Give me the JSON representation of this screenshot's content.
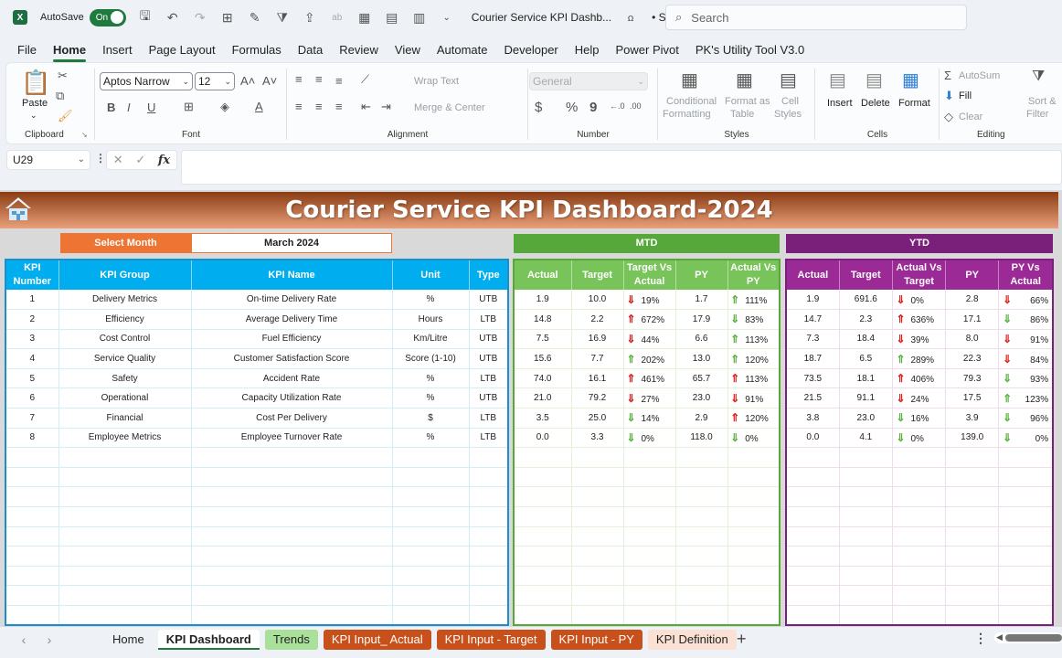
{
  "titlebar": {
    "app_icon": "excel-icon",
    "autosave_label": "AutoSave",
    "autosave_state": "On",
    "doc_title": "Courier Service KPI Dashb...",
    "saved_status": "• Saved",
    "search_placeholder": "Search"
  },
  "menu": {
    "tabs": [
      "File",
      "Home",
      "Insert",
      "Page Layout",
      "Formulas",
      "Data",
      "Review",
      "View",
      "Automate",
      "Developer",
      "Help",
      "Power Pivot",
      "PK's Utility Tool V3.0"
    ],
    "active": "Home"
  },
  "ribbon": {
    "clipboard": {
      "label": "Clipboard",
      "paste": "Paste"
    },
    "font": {
      "label": "Font",
      "font_name": "Aptos Narrow",
      "font_size": "12",
      "bold": "B",
      "italic": "I",
      "underline": "U"
    },
    "alignment": {
      "label": "Alignment",
      "wrap_text": "Wrap Text",
      "merge_center": "Merge & Center"
    },
    "number": {
      "label": "Number",
      "format": "General",
      "currency": "$",
      "percent": "%",
      "comma": "9"
    },
    "styles": {
      "label": "Styles",
      "conditional": "Conditional",
      "conditional2": "Formatting",
      "format_as": "Format as",
      "format_as2": "Table",
      "cell": "Cell",
      "cell2": "Styles"
    },
    "cells": {
      "label": "Cells",
      "insert": "Insert",
      "delete": "Delete",
      "format": "Format"
    },
    "editing": {
      "label": "Editing",
      "autosum": "AutoSum",
      "fill": "Fill",
      "clear": "Clear",
      "sort": "Sort &",
      "sort2": "Filter"
    }
  },
  "formula_bar": {
    "name_box": "U29",
    "formula": ""
  },
  "dashboard": {
    "title": "Courier Service KPI Dashboard-2024",
    "select_month_label": "Select Month",
    "selected_month": "March 2024",
    "mtd_label": "MTD",
    "ytd_label": "YTD",
    "kpi_headers": [
      "KPI Number",
      "KPI Group",
      "KPI Name",
      "Unit",
      "Type"
    ],
    "mtd_headers": [
      "Actual",
      "Target",
      "Target Vs Actual",
      "PY",
      "Actual Vs PY"
    ],
    "ytd_headers": [
      "Actual",
      "Target",
      "Actual Vs Target",
      "PY",
      "PY Vs Actual"
    ],
    "rows": [
      {
        "num": "1",
        "group": "Delivery Metrics",
        "name": "On-time Delivery Rate",
        "unit": "%",
        "type": "UTB",
        "mtd": {
          "actual": "1.9",
          "target": "10.0",
          "tva": "19%",
          "tva_dir": "down",
          "tva_color": "red",
          "py": "1.7",
          "avp": "111%",
          "avp_dir": "up",
          "avp_color": "green"
        },
        "ytd": {
          "actual": "1.9",
          "target": "691.6",
          "avt": "0%",
          "avt_dir": "down",
          "avt_color": "red",
          "py": "2.8",
          "pva": "66%",
          "pva_dir": "down",
          "pva_color": "red"
        }
      },
      {
        "num": "2",
        "group": "Efficiency",
        "name": "Average Delivery Time",
        "unit": "Hours",
        "type": "LTB",
        "mtd": {
          "actual": "14.8",
          "target": "2.2",
          "tva": "672%",
          "tva_dir": "up",
          "tva_color": "red",
          "py": "17.9",
          "avp": "83%",
          "avp_dir": "down",
          "avp_color": "green"
        },
        "ytd": {
          "actual": "14.7",
          "target": "2.3",
          "avt": "636%",
          "avt_dir": "up",
          "avt_color": "red",
          "py": "17.1",
          "pva": "86%",
          "pva_dir": "down",
          "pva_color": "green"
        }
      },
      {
        "num": "3",
        "group": "Cost Control",
        "name": "Fuel Efficiency",
        "unit": "Km/Litre",
        "type": "UTB",
        "mtd": {
          "actual": "7.5",
          "target": "16.9",
          "tva": "44%",
          "tva_dir": "down",
          "tva_color": "red",
          "py": "6.6",
          "avp": "113%",
          "avp_dir": "up",
          "avp_color": "green"
        },
        "ytd": {
          "actual": "7.3",
          "target": "18.4",
          "avt": "39%",
          "avt_dir": "down",
          "avt_color": "red",
          "py": "8.0",
          "pva": "91%",
          "pva_dir": "down",
          "pva_color": "red"
        }
      },
      {
        "num": "4",
        "group": "Service Quality",
        "name": "Customer Satisfaction Score",
        "unit": "Score (1-10)",
        "type": "UTB",
        "mtd": {
          "actual": "15.6",
          "target": "7.7",
          "tva": "202%",
          "tva_dir": "up",
          "tva_color": "green",
          "py": "13.0",
          "avp": "120%",
          "avp_dir": "up",
          "avp_color": "green"
        },
        "ytd": {
          "actual": "18.7",
          "target": "6.5",
          "avt": "289%",
          "avt_dir": "up",
          "avt_color": "green",
          "py": "22.3",
          "pva": "84%",
          "pva_dir": "down",
          "pva_color": "red"
        }
      },
      {
        "num": "5",
        "group": "Safety",
        "name": "Accident Rate",
        "unit": "%",
        "type": "LTB",
        "mtd": {
          "actual": "74.0",
          "target": "16.1",
          "tva": "461%",
          "tva_dir": "up",
          "tva_color": "red",
          "py": "65.7",
          "avp": "113%",
          "avp_dir": "up",
          "avp_color": "red"
        },
        "ytd": {
          "actual": "73.5",
          "target": "18.1",
          "avt": "406%",
          "avt_dir": "up",
          "avt_color": "red",
          "py": "79.3",
          "pva": "93%",
          "pva_dir": "down",
          "pva_color": "green"
        }
      },
      {
        "num": "6",
        "group": "Operational",
        "name": "Capacity Utilization Rate",
        "unit": "%",
        "type": "UTB",
        "mtd": {
          "actual": "21.0",
          "target": "79.2",
          "tva": "27%",
          "tva_dir": "down",
          "tva_color": "red",
          "py": "23.0",
          "avp": "91%",
          "avp_dir": "down",
          "avp_color": "red"
        },
        "ytd": {
          "actual": "21.5",
          "target": "91.1",
          "avt": "24%",
          "avt_dir": "down",
          "avt_color": "red",
          "py": "17.5",
          "pva": "123%",
          "pva_dir": "up",
          "pva_color": "green"
        }
      },
      {
        "num": "7",
        "group": "Financial",
        "name": "Cost Per Delivery",
        "unit": "$",
        "type": "LTB",
        "mtd": {
          "actual": "3.5",
          "target": "25.0",
          "tva": "14%",
          "tva_dir": "down",
          "tva_color": "green",
          "py": "2.9",
          "avp": "120%",
          "avp_dir": "up",
          "avp_color": "red"
        },
        "ytd": {
          "actual": "3.8",
          "target": "23.0",
          "avt": "16%",
          "avt_dir": "down",
          "avt_color": "green",
          "py": "3.9",
          "pva": "96%",
          "pva_dir": "down",
          "pva_color": "green"
        }
      },
      {
        "num": "8",
        "group": "Employee Metrics",
        "name": "Employee Turnover Rate",
        "unit": "%",
        "type": "LTB",
        "mtd": {
          "actual": "0.0",
          "target": "3.3",
          "tva": "0%",
          "tva_dir": "down",
          "tva_color": "green",
          "py": "118.0",
          "avp": "0%",
          "avp_dir": "down",
          "avp_color": "green"
        },
        "ytd": {
          "actual": "0.0",
          "target": "4.1",
          "avt": "0%",
          "avt_dir": "down",
          "avt_color": "green",
          "py": "139.0",
          "pva": "0%",
          "pva_dir": "down",
          "pva_color": "green"
        }
      }
    ],
    "empty_rows": 9
  },
  "sheet_tabs": [
    {
      "label": "Home",
      "style": "plain"
    },
    {
      "label": "KPI Dashboard",
      "style": "active"
    },
    {
      "label": "Trends",
      "style": "green"
    },
    {
      "label": "KPI Input_ Actual",
      "style": "orange"
    },
    {
      "label": "KPI Input - Target",
      "style": "orange"
    },
    {
      "label": "KPI Input - PY",
      "style": "orange"
    },
    {
      "label": "KPI Definition",
      "style": "peach"
    }
  ],
  "colors": {
    "excel_green": "#1f7a3e",
    "banner_dark": "#8b3d14",
    "orange": "#ed7433",
    "kpi_blue": "#00aeef",
    "mtd_green": "#57a83a",
    "ytd_purple": "#7a1f7a",
    "arrow_red": "#e02020",
    "arrow_green": "#5cb040"
  }
}
